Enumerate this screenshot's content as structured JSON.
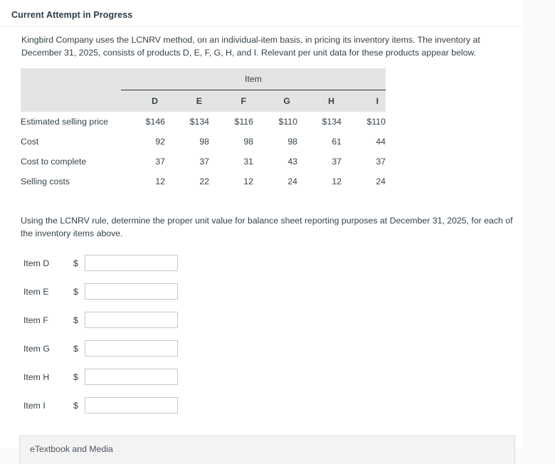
{
  "header": {
    "title": "Current Attempt in Progress"
  },
  "intro": {
    "text": "Kingbird Company uses the LCNRV method, on an individual-item basis, in pricing its inventory items. The inventory at December 31, 2025, consists of products D, E, F, G, H, and I. Relevant per unit data for these products appear below."
  },
  "table": {
    "group_header": "Item",
    "columns": [
      "D",
      "E",
      "F",
      "G",
      "H",
      "I"
    ],
    "rows": [
      {
        "label": "Estimated selling price",
        "values": [
          "$146",
          "$134",
          "$116",
          "$110",
          "$134",
          "$110"
        ]
      },
      {
        "label": "Cost",
        "values": [
          "92",
          "98",
          "98",
          "98",
          "61",
          "44"
        ]
      },
      {
        "label": "Cost to complete",
        "values": [
          "37",
          "37",
          "31",
          "43",
          "37",
          "37"
        ]
      },
      {
        "label": "Selling costs",
        "values": [
          "12",
          "22",
          "12",
          "24",
          "12",
          "24"
        ]
      }
    ]
  },
  "prompt": {
    "text": "Using the LCNRV rule, determine the proper unit value for balance sheet reporting purposes at December 31, 2025, for each of the inventory items above."
  },
  "answers": {
    "currency_symbol": "$",
    "placeholder": "",
    "rows": [
      {
        "label": "Item D",
        "value": ""
      },
      {
        "label": "Item E",
        "value": ""
      },
      {
        "label": "Item F",
        "value": ""
      },
      {
        "label": "Item G",
        "value": ""
      },
      {
        "label": "Item H",
        "value": ""
      },
      {
        "label": "Item I",
        "value": ""
      }
    ]
  },
  "footer": {
    "etextbook_label": "eTextbook and Media"
  },
  "colors": {
    "page_background": "#ffffff",
    "outer_background": "#fafafa",
    "table_header_background": "#e4e4e4",
    "text": "#35424a",
    "input_border": "#c7c7c7"
  }
}
